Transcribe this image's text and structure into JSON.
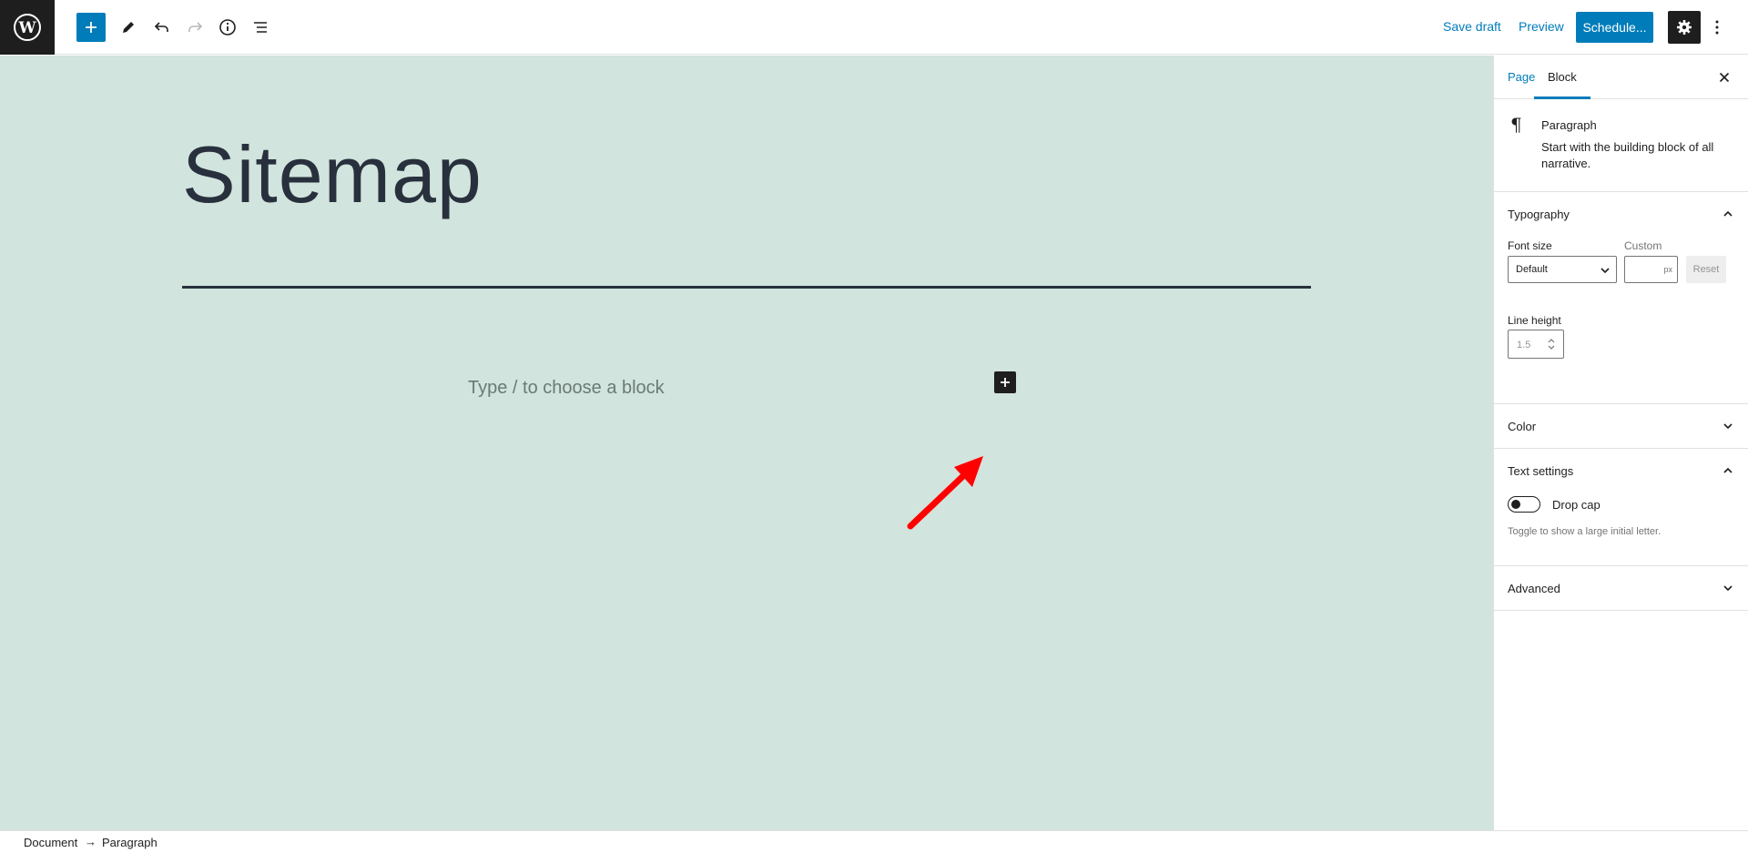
{
  "toolbar": {
    "save_draft": "Save draft",
    "preview": "Preview",
    "schedule": "Schedule...",
    "accent_color": "#007cba"
  },
  "editor": {
    "title": "Sitemap",
    "placeholder": "Type / to choose a block",
    "canvas_color": "#d1e4dd"
  },
  "sidebar": {
    "tabs": [
      "Page",
      "Block"
    ],
    "active_tab": "Block",
    "block_card": {
      "title": "Paragraph",
      "description": "Start with the building block of all narrative."
    },
    "typography": {
      "heading": "Typography",
      "font_size_label": "Font size",
      "custom_label": "Custom",
      "font_size_value": "Default",
      "custom_unit": "px",
      "reset": "Reset",
      "line_height_label": "Line height",
      "line_height_value": "1.5"
    },
    "color": {
      "heading": "Color"
    },
    "text_settings": {
      "heading": "Text settings",
      "drop_cap_label": "Drop cap",
      "drop_cap_help": "Toggle to show a large initial letter."
    },
    "advanced": {
      "heading": "Advanced"
    }
  },
  "footer": {
    "breadcrumb": [
      "Document",
      "Paragraph"
    ],
    "separator": "→"
  }
}
